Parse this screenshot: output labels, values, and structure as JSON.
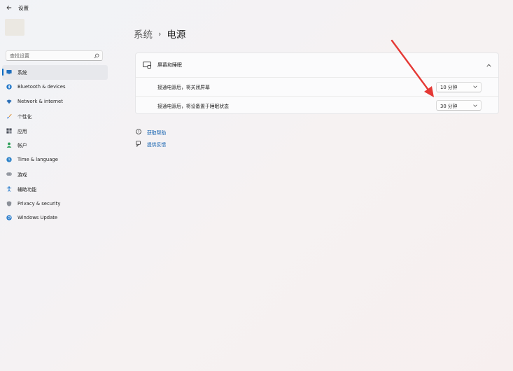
{
  "titlebar": {
    "title": "设置"
  },
  "search": {
    "placeholder": "查找设置"
  },
  "sidebar": {
    "items": [
      {
        "label": "系统",
        "icon": "monitor-icon",
        "active": true
      },
      {
        "label": "Bluetooth & devices",
        "icon": "bluetooth-icon"
      },
      {
        "label": "Network & internet",
        "icon": "wifi-icon"
      },
      {
        "label": "个性化",
        "icon": "brush-icon"
      },
      {
        "label": "应用",
        "icon": "apps-icon"
      },
      {
        "label": "帐户",
        "icon": "person-icon"
      },
      {
        "label": "Time & language",
        "icon": "globe-clock-icon"
      },
      {
        "label": "游戏",
        "icon": "gamepad-icon"
      },
      {
        "label": "辅助功能",
        "icon": "accessibility-icon"
      },
      {
        "label": "Privacy & security",
        "icon": "shield-icon"
      },
      {
        "label": "Windows Update",
        "icon": "update-icon"
      }
    ]
  },
  "breadcrumb": {
    "parent": "系统",
    "separator": "›",
    "current": "电源"
  },
  "card": {
    "title": "屏幕和睡眠",
    "rows": [
      {
        "label": "接通电源后，将关闭屏幕",
        "value": "10 分钟"
      },
      {
        "label": "接通电源后，将设备置于睡眠状态",
        "value": "30 分钟"
      }
    ]
  },
  "links": [
    {
      "label": "获取帮助",
      "icon": "help-icon"
    },
    {
      "label": "提供反馈",
      "icon": "feedback-icon"
    }
  ],
  "colors": {
    "accent": "#0067c0",
    "link": "#0b5cad",
    "annotation_arrow": "#e53935"
  }
}
